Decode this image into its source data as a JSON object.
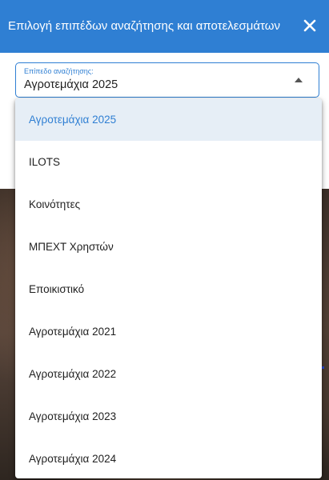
{
  "header": {
    "title": "Επιλογή επιπέδων αναζήτησης και αποτελεσμάτων",
    "close_icon": "close-icon"
  },
  "select": {
    "label": "Επίπεδο αναζήτησης:",
    "value": "Αγροτεμάχια 2025",
    "arrow_icon": "caret-up-icon"
  },
  "dropdown": {
    "options": [
      {
        "label": "Αγροτεμάχια 2025",
        "selected": true
      },
      {
        "label": "ILOTS",
        "selected": false
      },
      {
        "label": "Κοινότητες",
        "selected": false
      },
      {
        "label": "ΜΠΕΧΤ Χρηστών",
        "selected": false
      },
      {
        "label": "Εποικιστικό",
        "selected": false
      },
      {
        "label": "Αγροτεμάχια 2021",
        "selected": false
      },
      {
        "label": "Αγροτεμάχια 2022",
        "selected": false
      },
      {
        "label": "Αγροτεμάχια 2023",
        "selected": false
      },
      {
        "label": "Αγροτεμάχια 2024",
        "selected": false
      }
    ]
  },
  "colors": {
    "header_bg": "#2f7fd3",
    "accent": "#2f7fd3",
    "selected_bg": "#e6eef6",
    "text": "#1f1f1f"
  }
}
